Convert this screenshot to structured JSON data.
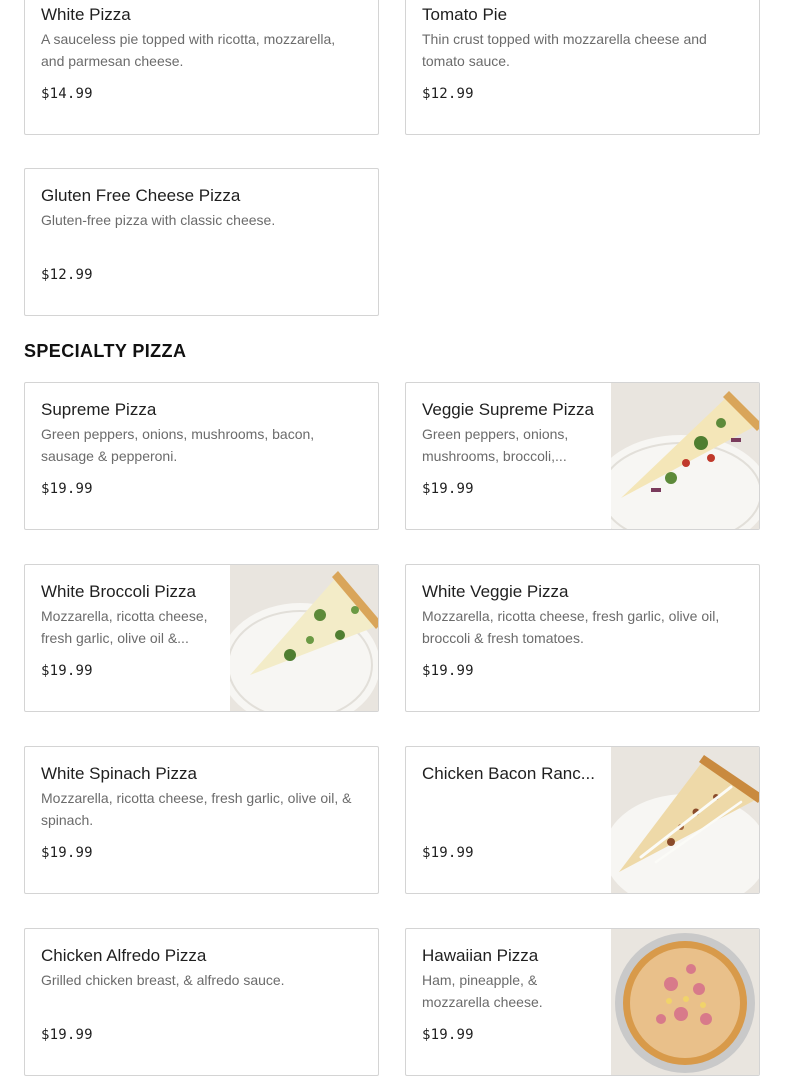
{
  "cheese_section": {
    "items": [
      {
        "name": "White Pizza",
        "description": "A sauceless pie topped with ricotta, mozzarella, and parmesan cheese.",
        "price": "$14.99"
      },
      {
        "name": "Tomato Pie",
        "description": "Thin crust topped with mozzarella cheese and tomato sauce.",
        "price": "$12.99"
      },
      {
        "name": "Gluten Free Cheese Pizza",
        "description": "Gluten-free pizza with classic cheese.",
        "price": "$12.99"
      }
    ]
  },
  "specialty_section": {
    "title": "SPECIALTY PIZZA",
    "items": [
      {
        "name": "Supreme Pizza",
        "description": "Green peppers, onions, mushrooms, bacon, sausage & pepperoni.",
        "price": "$19.99"
      },
      {
        "name": "Veggie Supreme Pizza",
        "description": "Green peppers, onions, mushrooms, broccoli,...",
        "price": "$19.99"
      },
      {
        "name": "White Broccoli Pizza",
        "description": "Mozzarella, ricotta cheese, fresh garlic, olive oil &...",
        "price": "$19.99"
      },
      {
        "name": "White Veggie Pizza",
        "description": "Mozzarella, ricotta cheese, fresh garlic, olive oil, broccoli & fresh tomatoes.",
        "price": "$19.99"
      },
      {
        "name": "White Spinach Pizza",
        "description": "Mozzarella, ricotta cheese, fresh garlic, olive oil, & spinach.",
        "price": "$19.99"
      },
      {
        "name": "Chicken Bacon Ranc...",
        "description": "",
        "price": "$19.99"
      },
      {
        "name": "Chicken Alfredo Pizza",
        "description": "Grilled chicken breast, & alfredo sauce.",
        "price": "$19.99"
      },
      {
        "name": "Hawaiian Pizza",
        "description": "Ham, pineapple, & mozzarella cheese.",
        "price": "$19.99"
      }
    ]
  }
}
